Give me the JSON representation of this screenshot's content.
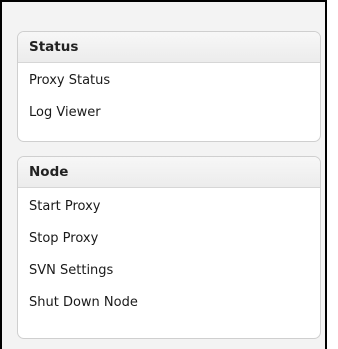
{
  "sections": {
    "status": {
      "title": "Status",
      "items": [
        "Proxy Status",
        "Log Viewer"
      ]
    },
    "node": {
      "title": "Node",
      "items": [
        "Start Proxy",
        "Stop Proxy",
        "SVN Settings",
        "Shut Down Node"
      ]
    }
  },
  "colors": {
    "frame_border": "#000000",
    "background": "#f3f3f3",
    "panel_background": "#ffffff",
    "panel_border": "#cfcfcf",
    "text": "#1a1a1a"
  }
}
